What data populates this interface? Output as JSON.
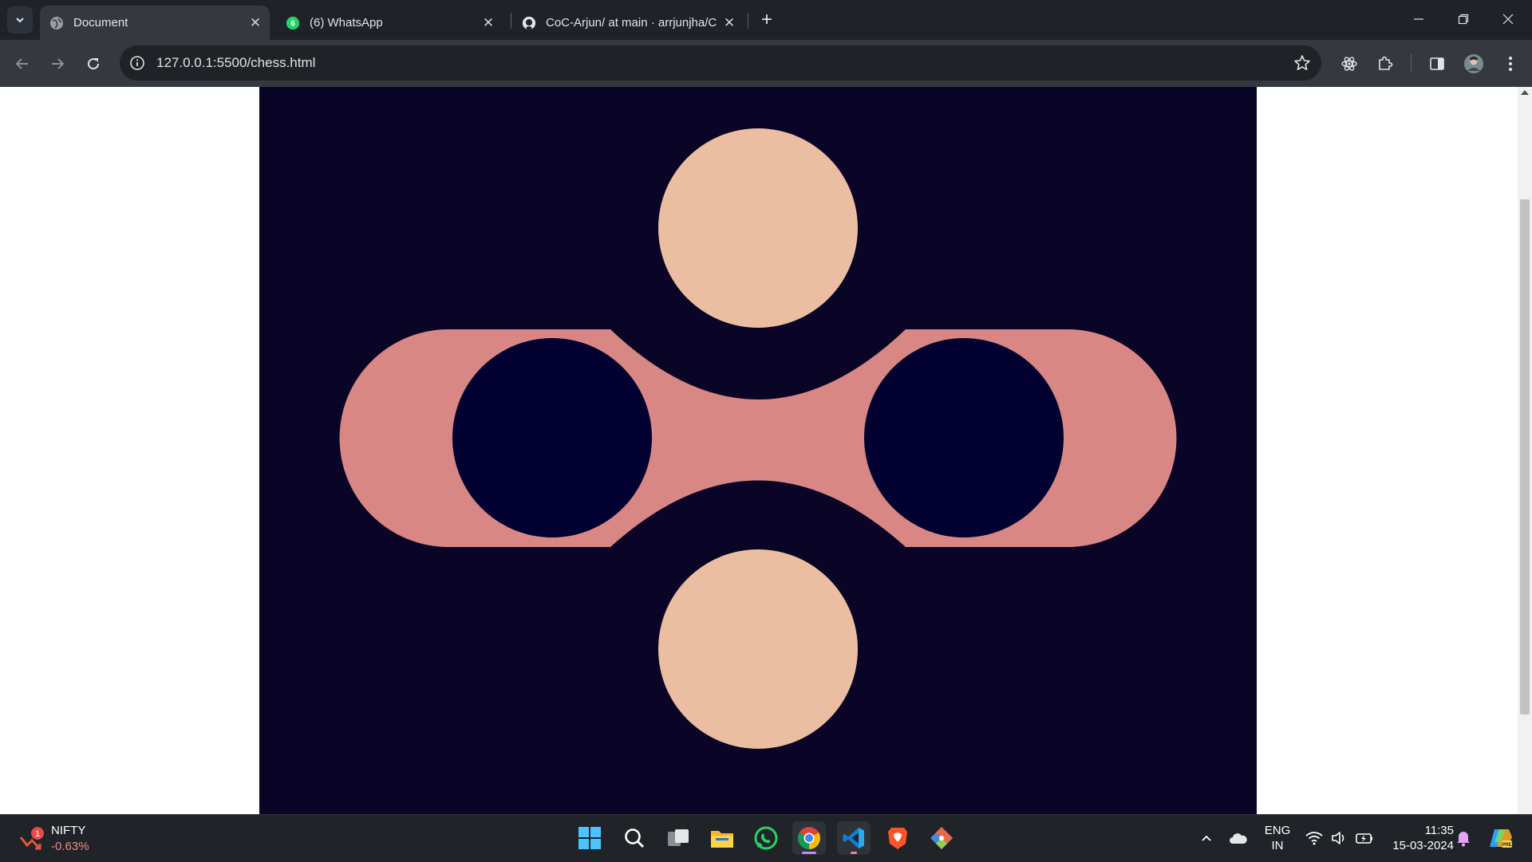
{
  "tabs": [
    {
      "title": "Document",
      "active": true,
      "favicon": "globe-icon"
    },
    {
      "title": "(6) WhatsApp",
      "active": false,
      "favicon": "whatsapp-icon",
      "badge": "6"
    },
    {
      "title": "CoC-Arjun/ at main · arrjunjha/C",
      "active": false,
      "favicon": "github-icon"
    }
  ],
  "address_bar": {
    "url": "127.0.0.1:5500/chess.html"
  },
  "page": {
    "background": "#0a0426",
    "colors": {
      "peach": "#ebbea1",
      "rose": "#d98785",
      "navy": "#010030"
    }
  },
  "taskbar": {
    "widget": {
      "name": "NIFTY",
      "change": "-0.63%",
      "badge": "1"
    },
    "language": {
      "line1": "ENG",
      "line2": "IN"
    },
    "clock": {
      "time": "11:35",
      "date": "15-03-2024"
    }
  }
}
